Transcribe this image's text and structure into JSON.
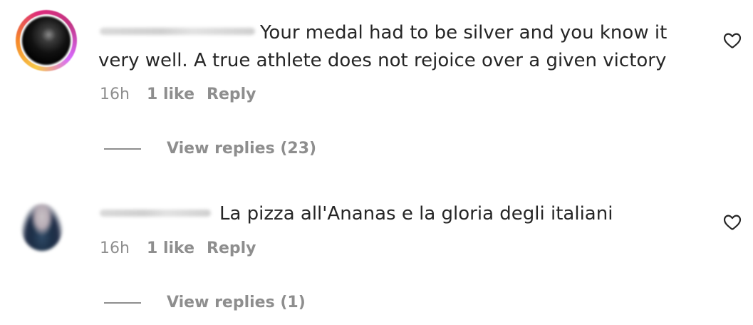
{
  "comments": [
    {
      "username_blurred": true,
      "text_line_1": "Your medal had to be silver and you know it",
      "text_line_2": "very well. A true athlete does not rejoice over a given victory",
      "time": "16h",
      "likes": "1 like",
      "reply_label": "Reply",
      "view_replies_label": "View replies (23)",
      "avatar_icon": "profile-avatar-story-ring",
      "like_icon": "heart-outline-icon"
    },
    {
      "username_blurred": true,
      "text_line_1": "La pizza all'Ananas e la gloria degli italiani",
      "time": "16h",
      "likes": "1 like",
      "reply_label": "Reply",
      "view_replies_label": "View replies (1)",
      "avatar_icon": "profile-avatar",
      "like_icon": "heart-outline-icon"
    }
  ],
  "colors": {
    "text_primary": "#262626",
    "text_secondary": "#8e8e8e",
    "background": "#ffffff"
  }
}
